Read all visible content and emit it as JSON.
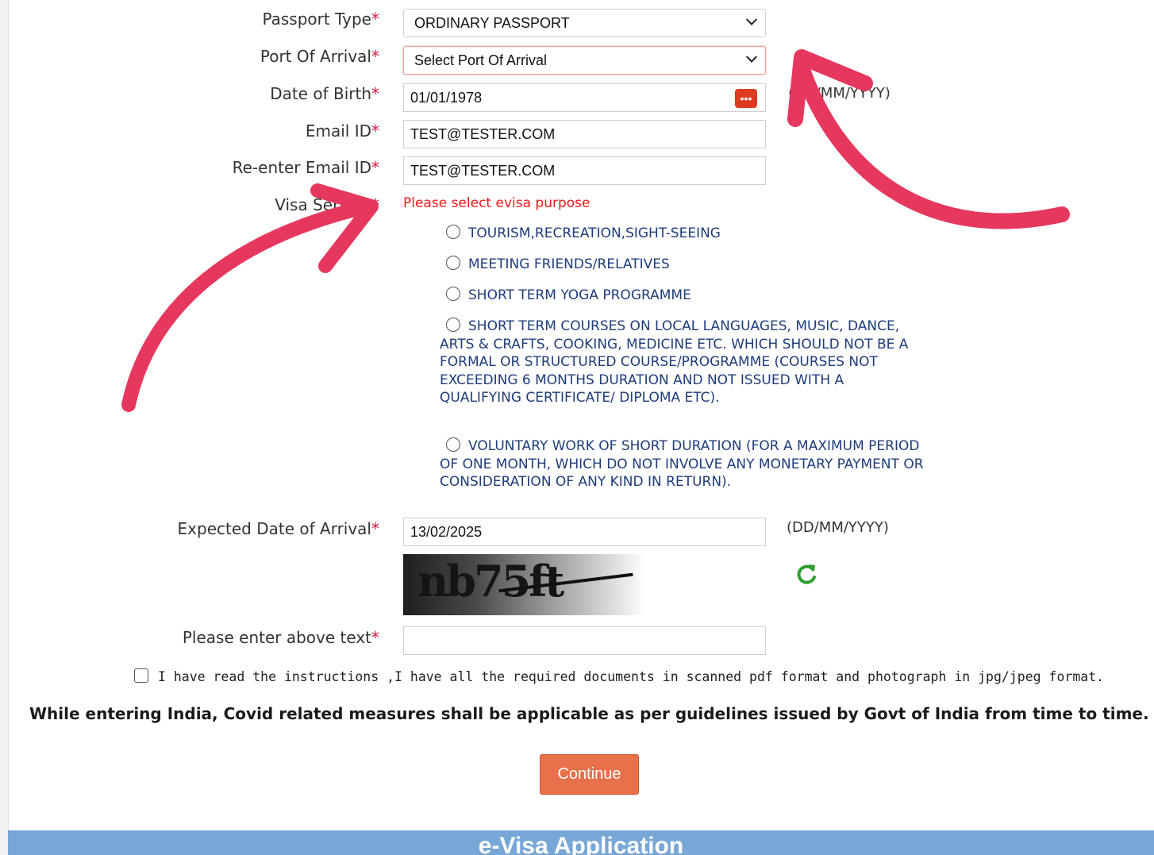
{
  "form": {
    "passport_type": {
      "label": "Passport Type",
      "req": "*",
      "value": "ORDINARY PASSPORT"
    },
    "port_of_arrival": {
      "label": "Port Of Arrival",
      "req": "*",
      "value": "Select Port Of Arrival"
    },
    "date_of_birth": {
      "label": "Date of Birth",
      "req": "*",
      "value": "01/01/1978",
      "hint": "(DD/MM/YYYY)",
      "cal_glyph": "•••"
    },
    "email": {
      "label": "Email ID",
      "req": "*",
      "value": "TEST@TESTER.COM"
    },
    "email_confirm": {
      "label": "Re-enter Email ID",
      "req": "*",
      "value": "TEST@TESTER.COM"
    },
    "visa_service": {
      "label": "Visa Service",
      "req": "*",
      "error": "Please select evisa purpose",
      "options": [
        "TOURISM,RECREATION,SIGHT-SEEING",
        "MEETING FRIENDS/RELATIVES",
        "SHORT TERM YOGA PROGRAMME",
        "SHORT TERM COURSES ON LOCAL LANGUAGES, MUSIC, DANCE, ARTS & CRAFTS, COOKING, MEDICINE ETC. WHICH SHOULD NOT BE A FORMAL OR STRUCTURED COURSE/PROGRAMME (COURSES NOT EXCEEDING 6 MONTHS DURATION AND NOT ISSUED WITH A QUALIFYING CERTIFICATE/ DIPLOMA ETC).",
        "VOLUNTARY WORK OF SHORT DURATION (FOR A MAXIMUM PERIOD OF ONE MONTH, WHICH DO NOT INVOLVE ANY MONETARY PAYMENT OR CONSIDERATION OF ANY KIND IN RETURN)."
      ]
    },
    "expected_arrival": {
      "label": "Expected Date of Arrival",
      "req": "*",
      "value": "13/02/2025",
      "hint": "(DD/MM/YYYY)"
    },
    "captcha": {
      "text": "nb75ft",
      "label": "Please enter above text",
      "req": "*",
      "value": ""
    },
    "declaration": "I have read the instructions ,I have all the required documents in scanned pdf format and photograph in jpg/jpeg format.",
    "covid_notice": "While entering India, Covid related measures shall be applicable as per guidelines issued by Govt of India from time to time.",
    "continue_label": "Continue"
  },
  "footer": {
    "title": "e-Visa Application"
  },
  "colors": {
    "required": "#e0143c",
    "error": "#f01818",
    "option_text": "#1e3c7a",
    "button": "#e8704a",
    "footer": "#77a7d6",
    "annotation_arrow": "#e6375f",
    "refresh": "#2e9e2e"
  }
}
